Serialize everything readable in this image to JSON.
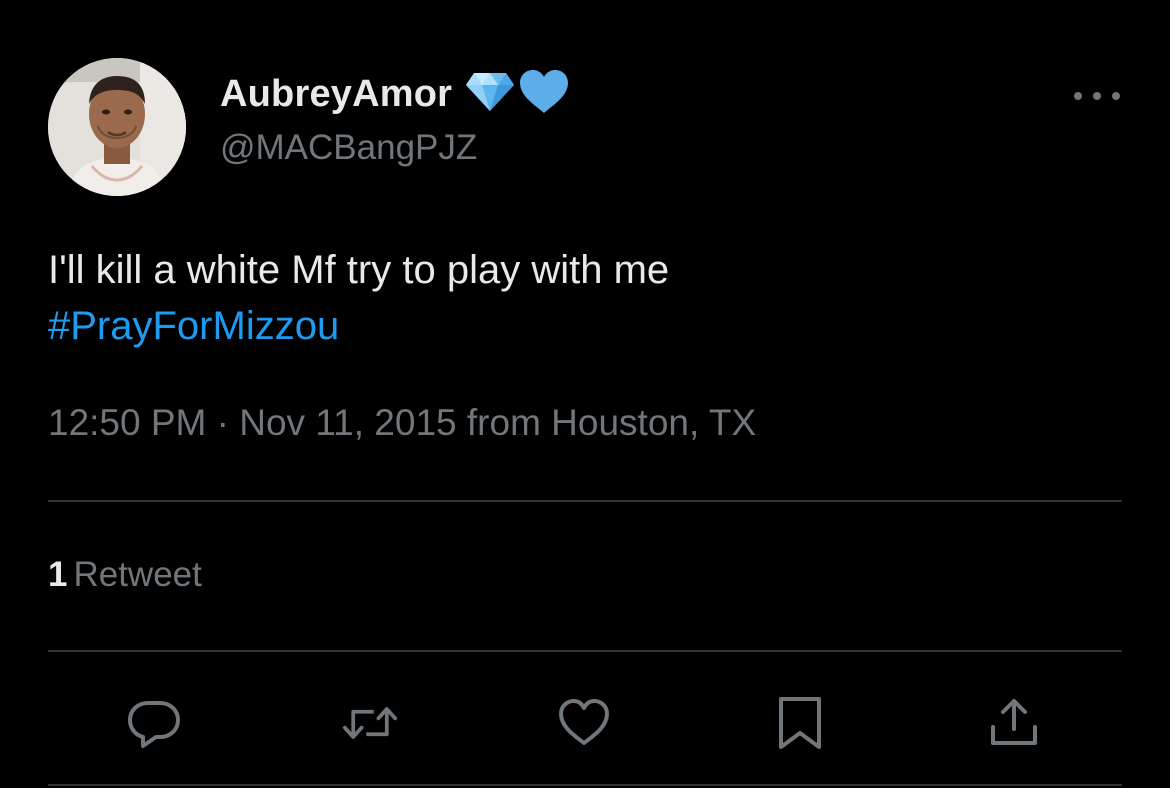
{
  "author": {
    "display_name": "AubreyAmor",
    "handle": "@MACBangPJZ",
    "badges": [
      "gem-stone-emoji",
      "blue-heart-emoji"
    ]
  },
  "tweet": {
    "text": "I'll kill a white Mf try to play with me",
    "hashtag": "#PrayForMizzou",
    "meta": "12:50 PM · Nov 11, 2015 from Houston, TX"
  },
  "stats": {
    "retweet_count": "1",
    "retweet_label": "Retweet"
  },
  "actions": [
    "reply-icon",
    "retweet-icon",
    "like-icon",
    "bookmark-icon",
    "share-icon"
  ],
  "colors": {
    "background": "#000000",
    "text": "#e7e9ea",
    "secondary": "#71767b",
    "link": "#1d9bf0",
    "divider": "#2f3336"
  }
}
